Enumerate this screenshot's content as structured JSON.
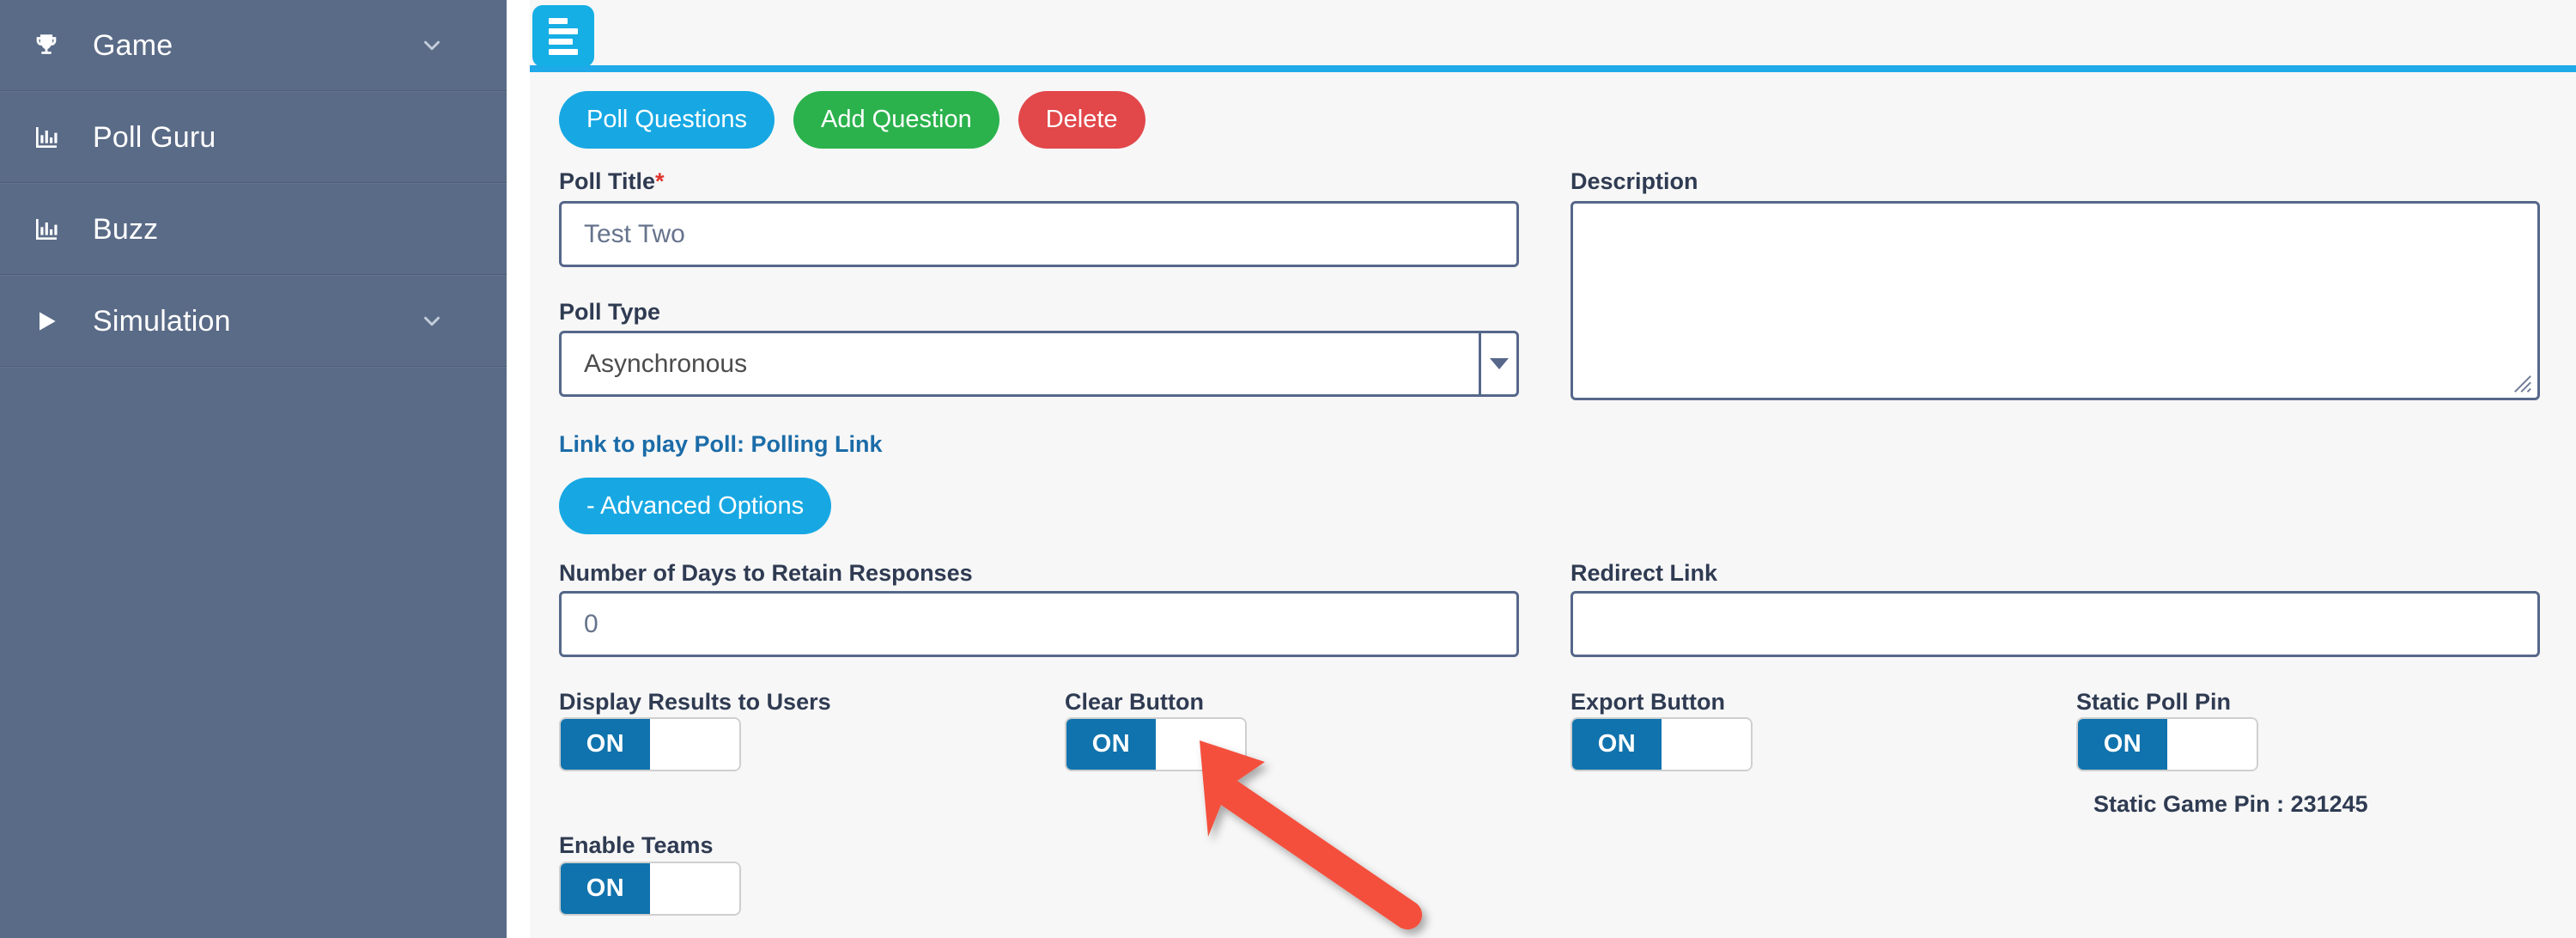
{
  "sidebar": {
    "items": [
      {
        "label": "Game",
        "icon": "trophy-icon",
        "chevron": true
      },
      {
        "label": "Poll Guru",
        "icon": "bar-chart-icon",
        "chevron": false
      },
      {
        "label": "Buzz",
        "icon": "bar-chart-icon",
        "chevron": false
      },
      {
        "label": "Simulation",
        "icon": "play-icon",
        "chevron": true
      }
    ]
  },
  "menu_tab": {
    "icon": "align-left-icon"
  },
  "toolbar": {
    "poll_questions_label": "Poll Questions",
    "add_question_label": "Add Question",
    "delete_label": "Delete"
  },
  "form": {
    "poll_title": {
      "label": "Poll Title",
      "required_marker": "*",
      "value": "Test Two"
    },
    "poll_type": {
      "label": "Poll Type",
      "value": "Asynchronous",
      "caret_icon": "chevron-down-icon"
    },
    "description": {
      "label": "Description",
      "value": ""
    },
    "play_link": {
      "prefix": "Link to play Poll: Polling Link"
    },
    "advanced_options_label": "- Advanced Options",
    "retain_days": {
      "label": "Number of Days to Retain Responses",
      "value": "0"
    },
    "redirect_link": {
      "label": "Redirect Link",
      "value": ""
    },
    "toggles": [
      {
        "label": "Display Results to Users",
        "state": "ON"
      },
      {
        "label": "Clear Button",
        "state": "ON"
      },
      {
        "label": "Export Button",
        "state": "ON"
      },
      {
        "label": "Static Poll Pin",
        "state": "ON"
      },
      {
        "label": "Enable Teams",
        "state": "ON"
      }
    ],
    "static_game_pin": "Static Game Pin : 231245"
  },
  "annotation": {
    "type": "arrow",
    "color": "#f4503c",
    "points_to": "clear-button-toggle"
  },
  "colors": {
    "sidebar_bg": "#5a6b87",
    "panel_bg": "#f7f7f7",
    "accent_blue": "#17a8e3",
    "panel_top_border": "#1fa9e8",
    "toggle_on": "#1073ad",
    "btn_green": "#2bb24c",
    "btn_red": "#e2474a",
    "label_text": "#2f3b52",
    "link_text": "#1b6ca8",
    "required_red": "#e0342c",
    "arrow_red": "#f4503c"
  }
}
